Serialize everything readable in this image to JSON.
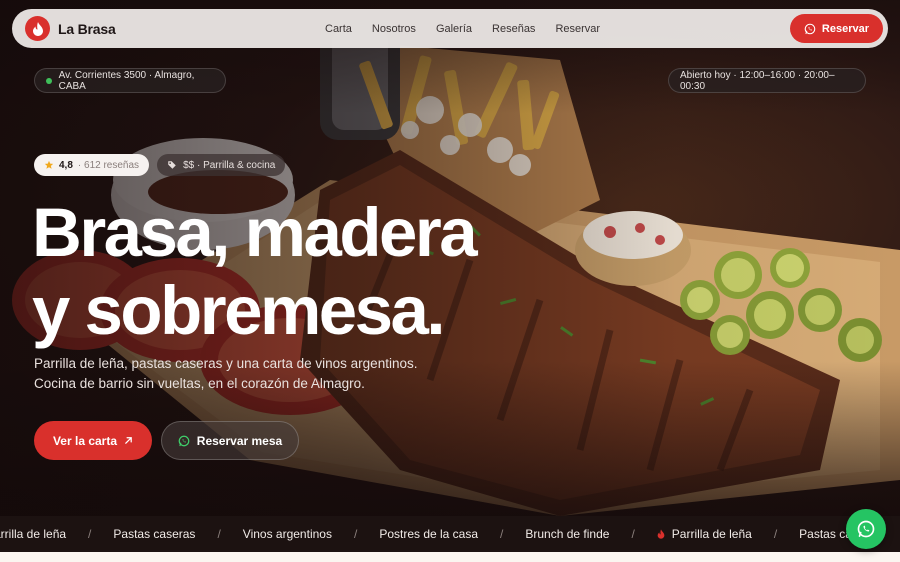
{
  "brand": {
    "name": "La Brasa",
    "logo_icon": "flame-icon"
  },
  "nav": {
    "links": [
      "Carta",
      "Nosotros",
      "Galería",
      "Reseñas",
      "Reservar"
    ],
    "cta_label": "Reservar",
    "cta_icon": "whatsapp-icon"
  },
  "info": {
    "address": "Av. Corrientes 3500 · Almagro, CABA",
    "hours": "Abierto hoy · 12:00–16:00 · 20:00–00:30"
  },
  "badges": {
    "rating": "4,8",
    "reviews": "· 612 reseñas",
    "price_category": "$$ · Parrilla & cocina"
  },
  "hero": {
    "headline_line1": "Brasa, madera",
    "headline_line2": "y sobremesa.",
    "lede_line1": "Parrilla de leña, pastas caseras y una carta de vinos argentinos.",
    "lede_line2": "Cocina de barrio sin vueltas, en el corazón de Almagro.",
    "primary_button": "Ver la carta",
    "secondary_button": "Reservar mesa"
  },
  "marquee": {
    "items": [
      "Parrilla de leña",
      "Pastas caseras",
      "Vinos argentinos",
      "Postres de la casa",
      "Brunch de finde",
      "Parrilla de leña",
      "Pastas caseras"
    ],
    "separator": "/"
  },
  "colors": {
    "accent": "#d9302c",
    "whatsapp": "#25c463",
    "dark": "#1c1211"
  }
}
